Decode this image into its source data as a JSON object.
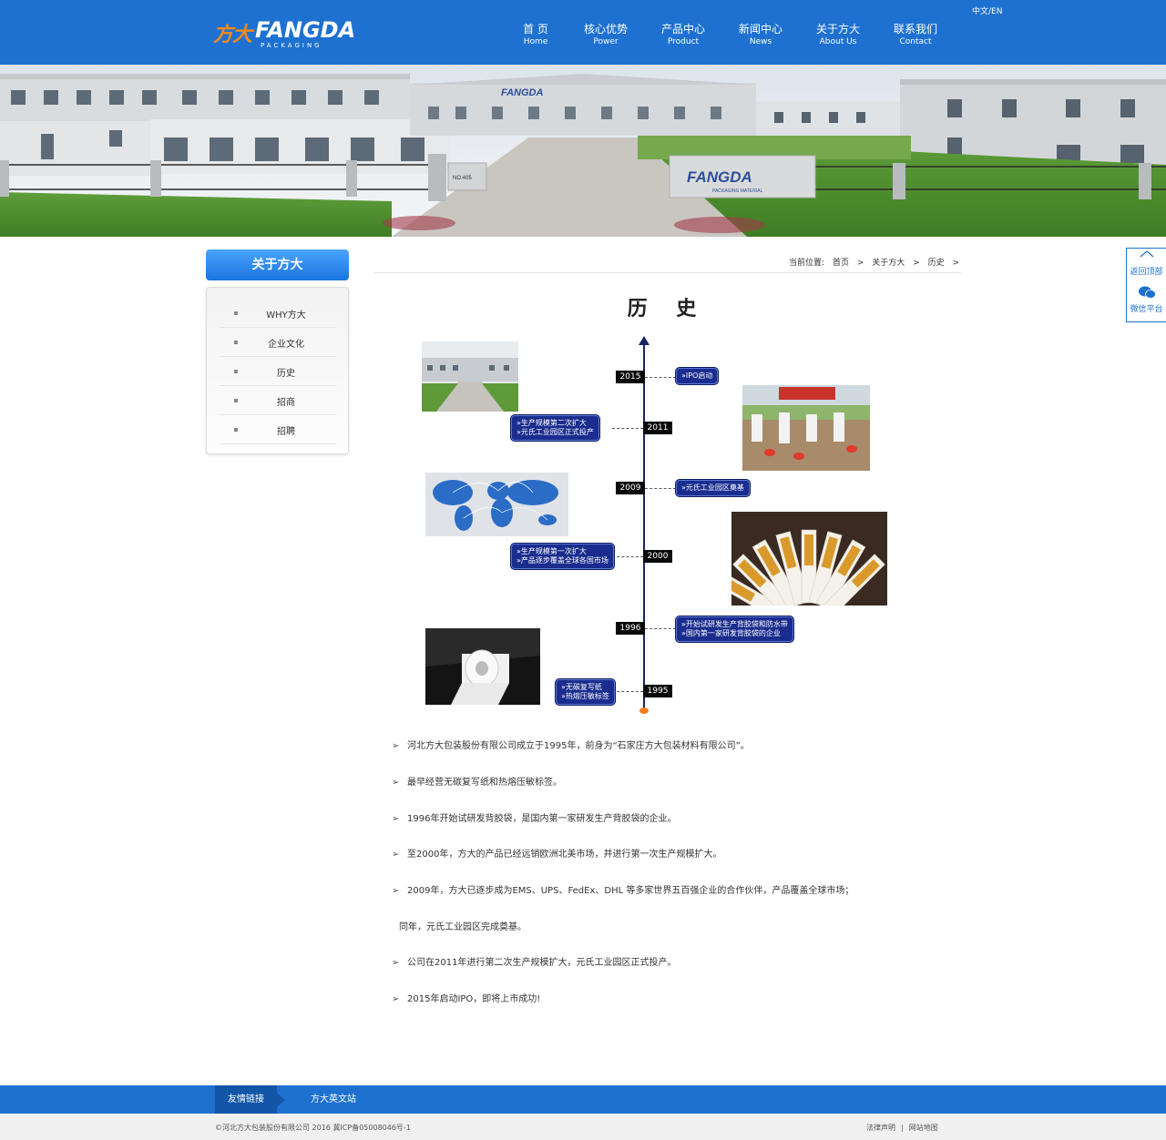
{
  "header": {
    "logo_cn": "方大",
    "logo_en": "FANGDA",
    "logo_sub": "PACKAGING",
    "lang": "中文/EN",
    "nav": [
      {
        "cn": "首 页",
        "en": "Home"
      },
      {
        "cn": "核心优势",
        "en": "Power"
      },
      {
        "cn": "产品中心",
        "en": "Product"
      },
      {
        "cn": "新闻中心",
        "en": "News"
      },
      {
        "cn": "关于方大",
        "en": "About Us"
      },
      {
        "cn": "联系我们",
        "en": "Contact"
      }
    ]
  },
  "banner": {
    "gate_sign": "FANGDA",
    "sub_sign": "PACKAGING MATERIAL",
    "building_sign": "FANGDA",
    "gate_no": "NO.405"
  },
  "sidebar": {
    "title": "关于方大",
    "items": [
      "WHY方大",
      "企业文化",
      "历史",
      "招商",
      "招聘"
    ]
  },
  "breadcrumb": {
    "label": "当前位置:",
    "items": [
      "首页",
      ">",
      "关于方大",
      ">",
      "历史",
      ">"
    ]
  },
  "page_title": "历 史",
  "timeline": {
    "years": [
      "2015",
      "2011",
      "2009",
      "2000",
      "1996",
      "1995"
    ],
    "events": [
      {
        "lines": [
          "»IPO启动"
        ]
      },
      {
        "lines": [
          "»生产规模第二次扩大",
          "»元氏工业园区正式投产"
        ]
      },
      {
        "lines": [
          "»元氏工业园区奠基"
        ]
      },
      {
        "lines": [
          "»生产规模第一次扩大",
          "»产品逐步覆盖全球各国市场"
        ]
      },
      {
        "lines": [
          "»开始试研发生产背胶袋和防水带",
          "»国内第一家研发背胶袋的企业"
        ]
      },
      {
        "lines": [
          "»无碳复写纸",
          "»热熔压敏标签"
        ]
      }
    ]
  },
  "history_text": [
    {
      "arrow": "➢",
      "text": "河北方大包装股份有限公司成立于1995年，前身为“石家庄方大包装材料有限公司”。"
    },
    {
      "arrow": "➢",
      "text": "最早经营无碳复写纸和热熔压敏标签。"
    },
    {
      "arrow": "➢",
      "text": "1996年开始试研发背胶袋，是国内第一家研发生产背胶袋的企业。"
    },
    {
      "arrow": "➢",
      "text": "至2000年，方大的产品已经远销欧洲北美市场，并进行第一次生产规模扩大。"
    },
    {
      "arrow": "➢",
      "text": "2009年，方大已逐步成为EMS、UPS、FedEx、DHL 等多家世界五百强企业的合作伙伴，产品覆盖全球市场；"
    },
    {
      "arrow": "",
      "text": "同年，元氏工业园区完成奠基。"
    },
    {
      "arrow": "➢",
      "text": "公司在2011年进行第二次生产规模扩大，元氏工业园区正式投产。"
    },
    {
      "arrow": "➢",
      "text": "2015年启动IPO，即将上市成功!"
    }
  ],
  "float_bar": {
    "top": "返回顶部",
    "wechat": "微信平台"
  },
  "footer_links": {
    "tab": "友情链接",
    "link": "方大英文站"
  },
  "footer": {
    "copyright": "©河北方大包装股份有限公司 2016 冀ICP备05008046号-1",
    "legal": "法律声明",
    "sep": "|",
    "sitemap": "网站地图"
  }
}
